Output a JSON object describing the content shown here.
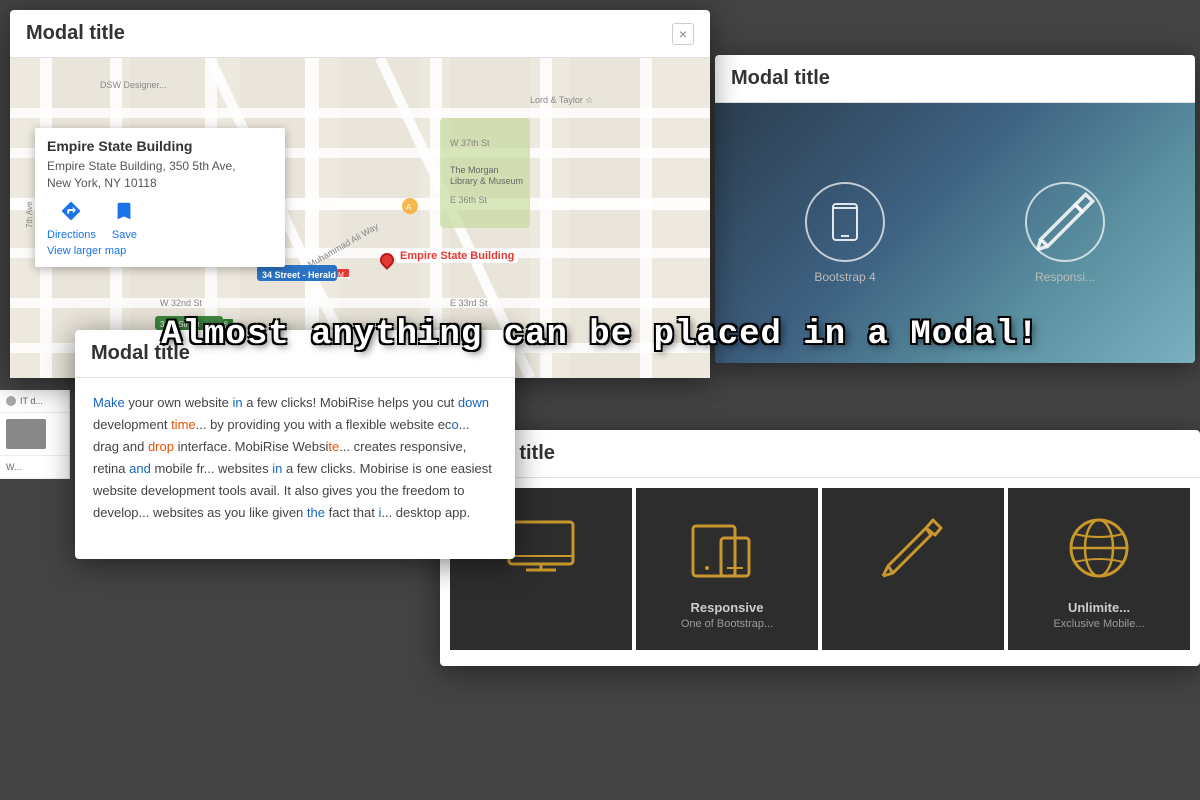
{
  "modal_map": {
    "title": "Modal title",
    "close_label": "×",
    "popup": {
      "title": "Empire State Building",
      "address": "Empire State Building, 350 5th Ave,\nNew York, NY 10118",
      "directions_label": "Directions",
      "save_label": "Save",
      "view_larger_label": "View larger map"
    },
    "pin_label": "Empire State Building"
  },
  "overlay_text": "Almost anything can be placed in a Modal!",
  "modal_bootstrap": {
    "title": "Modal title",
    "caption1": "Bootstrap 4",
    "caption2": "Responsi..."
  },
  "modal_text": {
    "title": "Modal title",
    "body": "Make your own website in a few clicks! MobiRise helps you cut down development time by providing you with a flexible website eco... drag and drop interface. MobiRise Websi... creates responsive, retina and mobile fr... websites in a few clicks. Mobirise is one easiest website development tools avail. It also gives you the freedom to develop websites as you like given the fact that i... desktop app."
  },
  "modal_icons": {
    "title": "Modal title",
    "cards": [
      {
        "label": "",
        "sublabel": ""
      },
      {
        "label": "Responsive",
        "sublabel": "One of Bootstrap..."
      },
      {
        "label": "",
        "sublabel": ""
      },
      {
        "label": "Unlimite...",
        "sublabel": "Exclusive Mobile..."
      }
    ]
  }
}
